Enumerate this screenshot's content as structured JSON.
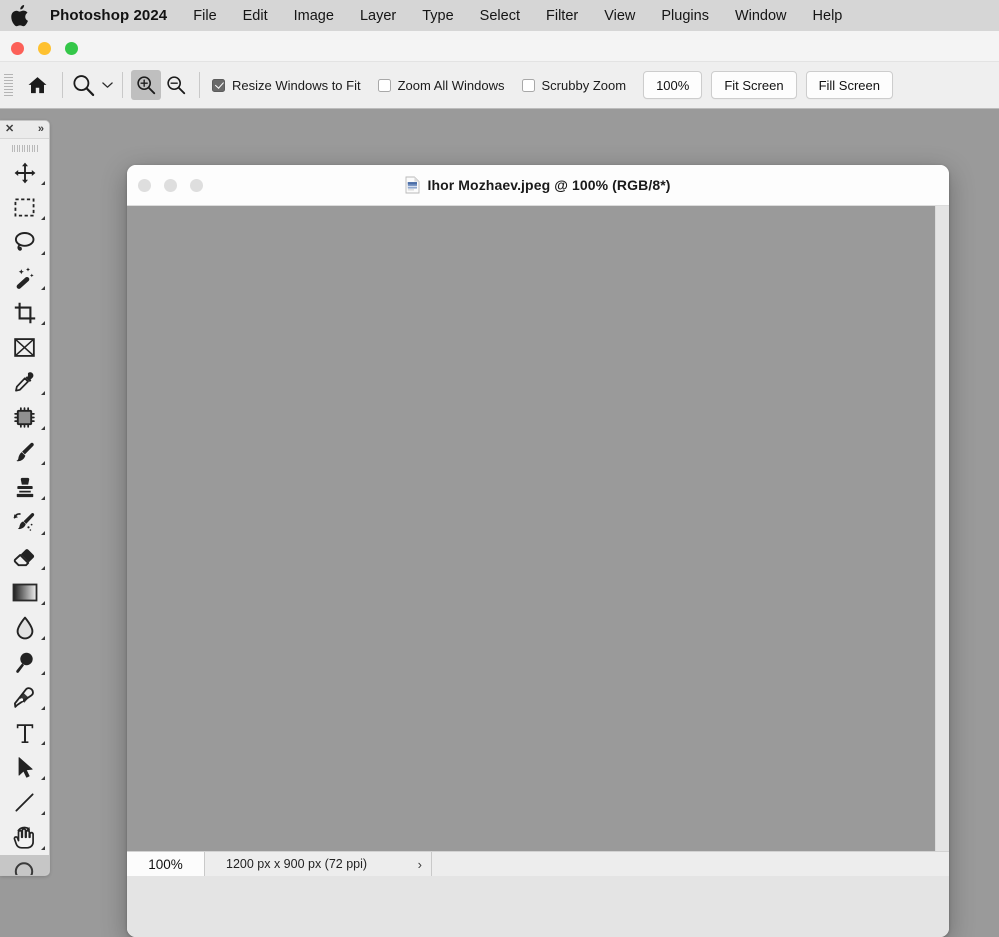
{
  "menubar": {
    "apple_icon": "apple-logo-icon",
    "app_name": "Photoshop 2024",
    "items": [
      {
        "label": "File"
      },
      {
        "label": "Edit"
      },
      {
        "label": "Image"
      },
      {
        "label": "Layer"
      },
      {
        "label": "Type"
      },
      {
        "label": "Select"
      },
      {
        "label": "Filter"
      },
      {
        "label": "View"
      },
      {
        "label": "Plugins"
      },
      {
        "label": "Window"
      },
      {
        "label": "Help"
      }
    ]
  },
  "window_controls": {
    "close": "close-button",
    "minimize": "minimize-button",
    "maximize": "maximize-button",
    "close_color": "#fc6058",
    "minimize_color": "#fec130",
    "maximize_color": "#34c749"
  },
  "options_bar": {
    "home_icon": "home-icon",
    "tool_icon": "zoom-tool-icon",
    "preset_chevron": "chevron-down-icon",
    "zoom_in_icon": "zoom-in-icon",
    "zoom_out_icon": "zoom-out-icon",
    "zoom_in_active": true,
    "checkboxes": [
      {
        "label": "Resize Windows to Fit",
        "checked": true
      },
      {
        "label": "Zoom All Windows",
        "checked": false
      },
      {
        "label": "Scrubby Zoom",
        "checked": false
      }
    ],
    "buttons": [
      {
        "label": "100%"
      },
      {
        "label": "Fit Screen"
      },
      {
        "label": "Fill Screen"
      }
    ]
  },
  "tool_palette": {
    "close_label": "✕",
    "expand_label": "»",
    "tools": [
      {
        "name": "move-tool",
        "icon": "move-icon",
        "has_submenu": true,
        "selected": false
      },
      {
        "name": "rectangular-marquee-tool",
        "icon": "marquee-icon",
        "has_submenu": true,
        "selected": false
      },
      {
        "name": "lasso-tool",
        "icon": "lasso-icon",
        "has_submenu": true,
        "selected": false
      },
      {
        "name": "object-selection-tool",
        "icon": "magic-wand-icon",
        "has_submenu": true,
        "selected": false
      },
      {
        "name": "crop-tool",
        "icon": "crop-icon",
        "has_submenu": true,
        "selected": false
      },
      {
        "name": "frame-tool",
        "icon": "frame-icon",
        "has_submenu": false,
        "selected": false
      },
      {
        "name": "eyedropper-tool",
        "icon": "eyedropper-icon",
        "has_submenu": true,
        "selected": false
      },
      {
        "name": "spot-healing-brush-tool",
        "icon": "healing-chip-icon",
        "has_submenu": true,
        "selected": false
      },
      {
        "name": "brush-tool",
        "icon": "brush-icon",
        "has_submenu": true,
        "selected": false
      },
      {
        "name": "clone-stamp-tool",
        "icon": "stamp-icon",
        "has_submenu": true,
        "selected": false
      },
      {
        "name": "history-brush-tool",
        "icon": "history-brush-icon",
        "has_submenu": true,
        "selected": false
      },
      {
        "name": "eraser-tool",
        "icon": "eraser-icon",
        "has_submenu": true,
        "selected": false
      },
      {
        "name": "gradient-tool",
        "icon": "gradient-icon",
        "has_submenu": true,
        "selected": false
      },
      {
        "name": "blur-tool",
        "icon": "blur-droplet-icon",
        "has_submenu": true,
        "selected": false
      },
      {
        "name": "dodge-tool",
        "icon": "dodge-icon",
        "has_submenu": true,
        "selected": false
      },
      {
        "name": "pen-tool",
        "icon": "pen-icon",
        "has_submenu": true,
        "selected": false
      },
      {
        "name": "type-tool",
        "icon": "type-icon",
        "has_submenu": true,
        "selected": false
      },
      {
        "name": "path-selection-tool",
        "icon": "path-arrow-icon",
        "has_submenu": true,
        "selected": false
      },
      {
        "name": "line-tool",
        "icon": "line-icon",
        "has_submenu": true,
        "selected": false
      },
      {
        "name": "hand-tool",
        "icon": "hand-rotate-icon",
        "has_submenu": true,
        "selected": false
      },
      {
        "name": "zoom-tool",
        "icon": "zoom-circle-icon",
        "has_submenu": false,
        "selected": true
      }
    ]
  },
  "document": {
    "title": "Ihor Mozhaev.jpeg @ 100% (RGB/8*)",
    "file_icon": "image-file-icon",
    "traffic_lights": [
      "close-button",
      "minimize-button",
      "maximize-button"
    ],
    "canvas_color": "#9a9a9a",
    "status_bar": {
      "zoom_level": "100%",
      "dimensions": "1200 px x 900 px (72 ppi)",
      "expand_chevron": "›"
    }
  }
}
